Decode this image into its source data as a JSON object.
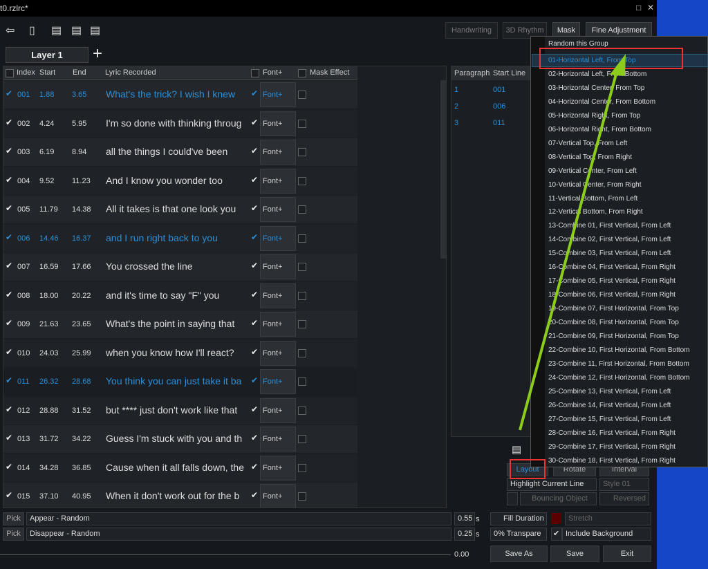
{
  "window": {
    "title": "t0.rzlrc*",
    "restore_icon": "□",
    "close_icon": "✕"
  },
  "toolbar": {
    "icons": [
      "back-icon",
      "book-icon",
      "add-list-icon",
      "delete-list-icon",
      "delete-all-icon"
    ],
    "tabs": [
      "Handwriting",
      "3D Rhythm",
      "Mask",
      "Fine Adjustment"
    ]
  },
  "layer": {
    "tab": "Layer 1",
    "add": "+"
  },
  "grid": {
    "headers": [
      "Index",
      "Start",
      "End",
      "Lyric Recorded",
      "Font+",
      "Mask Effect"
    ],
    "rows": [
      {
        "index": "001",
        "start": "1.88",
        "end": "3.65",
        "lyric": "What's the trick? I wish I knew",
        "font": "Font+",
        "blue": true
      },
      {
        "index": "002",
        "start": "4.24",
        "end": "5.95",
        "lyric": "I'm so done with thinking throug",
        "font": "Font+"
      },
      {
        "index": "003",
        "start": "6.19",
        "end": "8.94",
        "lyric": "all the things I could've been",
        "font": "Font+"
      },
      {
        "index": "004",
        "start": "9.52",
        "end": "11.23",
        "lyric": "And I know you wonder too",
        "font": "Font+"
      },
      {
        "index": "005",
        "start": "11.79",
        "end": "14.38",
        "lyric": "All it takes is that one look you",
        "font": "Font+"
      },
      {
        "index": "006",
        "start": "14.46",
        "end": "16.37",
        "lyric": "and I run right back to you",
        "font": "Font+",
        "blue": true
      },
      {
        "index": "007",
        "start": "16.59",
        "end": "17.66",
        "lyric": "You crossed the line",
        "font": "Font+"
      },
      {
        "index": "008",
        "start": "18.00",
        "end": "20.22",
        "lyric": "and it's time to say \"F\" you",
        "font": "Font+"
      },
      {
        "index": "009",
        "start": "21.63",
        "end": "23.65",
        "lyric": "What's the point in saying that",
        "font": "Font+"
      },
      {
        "index": "010",
        "start": "24.03",
        "end": "25.99",
        "lyric": "when you know how I'll react?",
        "font": "Font+"
      },
      {
        "index": "011",
        "start": "26.32",
        "end": "28.68",
        "lyric": "You think you can just take it ba",
        "font": "Font+",
        "blue": true
      },
      {
        "index": "012",
        "start": "28.88",
        "end": "31.52",
        "lyric": "but **** just don't work like that",
        "font": "Font+"
      },
      {
        "index": "013",
        "start": "31.72",
        "end": "34.22",
        "lyric": "Guess I'm stuck with you and th",
        "font": "Font+"
      },
      {
        "index": "014",
        "start": "34.28",
        "end": "36.85",
        "lyric": "Cause when it all falls down, the",
        "font": "Font+"
      },
      {
        "index": "015",
        "start": "37.10",
        "end": "40.95",
        "lyric": "When it don't work out for the b",
        "font": "Font+"
      }
    ]
  },
  "paragraphs": {
    "headers": [
      "Paragraph",
      "Start Line"
    ],
    "rows": [
      [
        "1",
        "001"
      ],
      [
        "2",
        "006"
      ],
      [
        "3",
        "011"
      ]
    ]
  },
  "menu": {
    "header": "Random this Group",
    "items": [
      "01-Horizontal Left, From Top",
      "02-Horizontal Left, From Bottom",
      "03-Horizontal Center, From Top",
      "04-Horizontal Center, From Bottom",
      "05-Horizontal Right, From Top",
      "06-Horizontal Right, From Bottom",
      "07-Vertical Top, From Left",
      "08-Vertical Top, From Right",
      "09-Vertical Center, From Left",
      "10-Vertical Center, From Right",
      "11-Vertical Bottom, From Left",
      "12-Vertical Bottom, From Right",
      "13-Combine 01, First Vertical, From Left",
      "14-Combine 02, First Vertical, From Left",
      "15-Combine 03, First Vertical, From Left",
      "16-Combine 04, First Vertical, From Right",
      "17-Combine 05, First Vertical, From Right",
      "18-Combine 06, First Vertical, From Right",
      "19-Combine 07, First Horizontal, From Top",
      "20-Combine 08, First Horizontal, From Top",
      "21-Combine 09, First Horizontal, From Top",
      "22-Combine 10, First Horizontal, From Bottom",
      "23-Combine 11, First Horizontal, From Bottom",
      "24-Combine 12, First Horizontal, From Bottom",
      "25-Combine 13, First Vertical, From Left",
      "26-Combine 14, First Vertical, From Left",
      "27-Combine 15, First Vertical, From Left",
      "28-Combine 16, First Vertical, From Right",
      "29-Combine 17, First Vertical, From Right",
      "30-Combine 18, First Vertical, From Right"
    ],
    "selected": 0
  },
  "options": {
    "layout": "Layout",
    "rotate": "Rotate",
    "interval": "Interval",
    "highlight": "Highlight Current Line",
    "style": "Style 01",
    "bouncing": "Bouncing Object",
    "reversed": "Reversed"
  },
  "bottom": {
    "pick": "Pick",
    "appear": "Appear - Random",
    "disappear": "Disappear - Random",
    "appear_dur": "0.55",
    "disappear_dur": "0.25",
    "unit": "s",
    "fill_duration": "Fill Duration",
    "stretch": "Stretch",
    "transparency": "0% Transpare",
    "include_bg": "Include Background",
    "timeline": "0.00",
    "save_as": "Save As",
    "save": "Save",
    "exit": "Exit",
    "fill_color": "#5a0000"
  },
  "colors": {
    "accent": "#2b8fd8",
    "annotation_box": "#e33333",
    "arrow": "#8ccc1a"
  }
}
